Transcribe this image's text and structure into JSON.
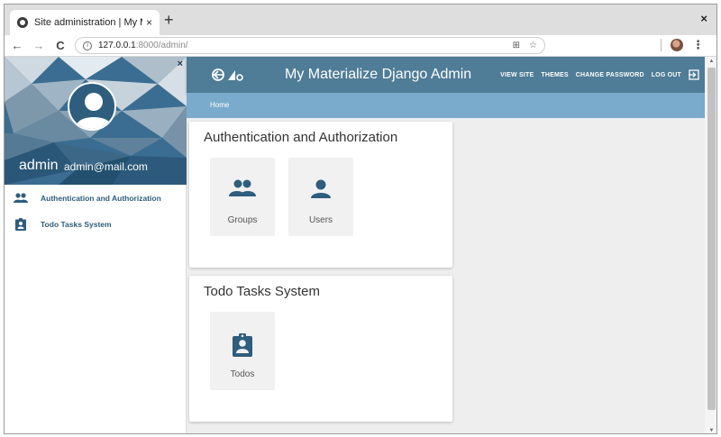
{
  "browser": {
    "tab_title": "Site administration | My M",
    "tab_close": "×",
    "new_tab": "+",
    "window_close": "×",
    "url_host": "127.0.0.1",
    "url_path": ":8000/admin/",
    "back": "←",
    "forward": "→",
    "reload": "C",
    "info": "i",
    "translate": "⊞",
    "bookmark": "☆",
    "menu": "⋮"
  },
  "sidebar": {
    "close": "×",
    "username": "admin",
    "email": "admin@mail.com",
    "items": [
      {
        "label": "Authentication and Authorization",
        "icon": "group-icon"
      },
      {
        "label": "Todo Tasks System",
        "icon": "assignment-ind-icon"
      }
    ]
  },
  "header": {
    "site_title": "My Materialize Django Admin",
    "links": [
      "VIEW SITE",
      "THEMES",
      "CHANGE PASSWORD",
      "LOG OUT"
    ]
  },
  "breadcrumb": {
    "home": "Home"
  },
  "apps": [
    {
      "name": "Authentication and Authorization",
      "models": [
        {
          "label": "Groups",
          "icon": "group-icon"
        },
        {
          "label": "Users",
          "icon": "person-icon"
        }
      ]
    },
    {
      "name": "Todo Tasks System",
      "models": [
        {
          "label": "Todos",
          "icon": "assignment-ind-icon"
        }
      ]
    }
  ],
  "colors": {
    "primary": "#4f7c96",
    "secondary": "#7aabcc",
    "icon": "#2e5d7e"
  }
}
